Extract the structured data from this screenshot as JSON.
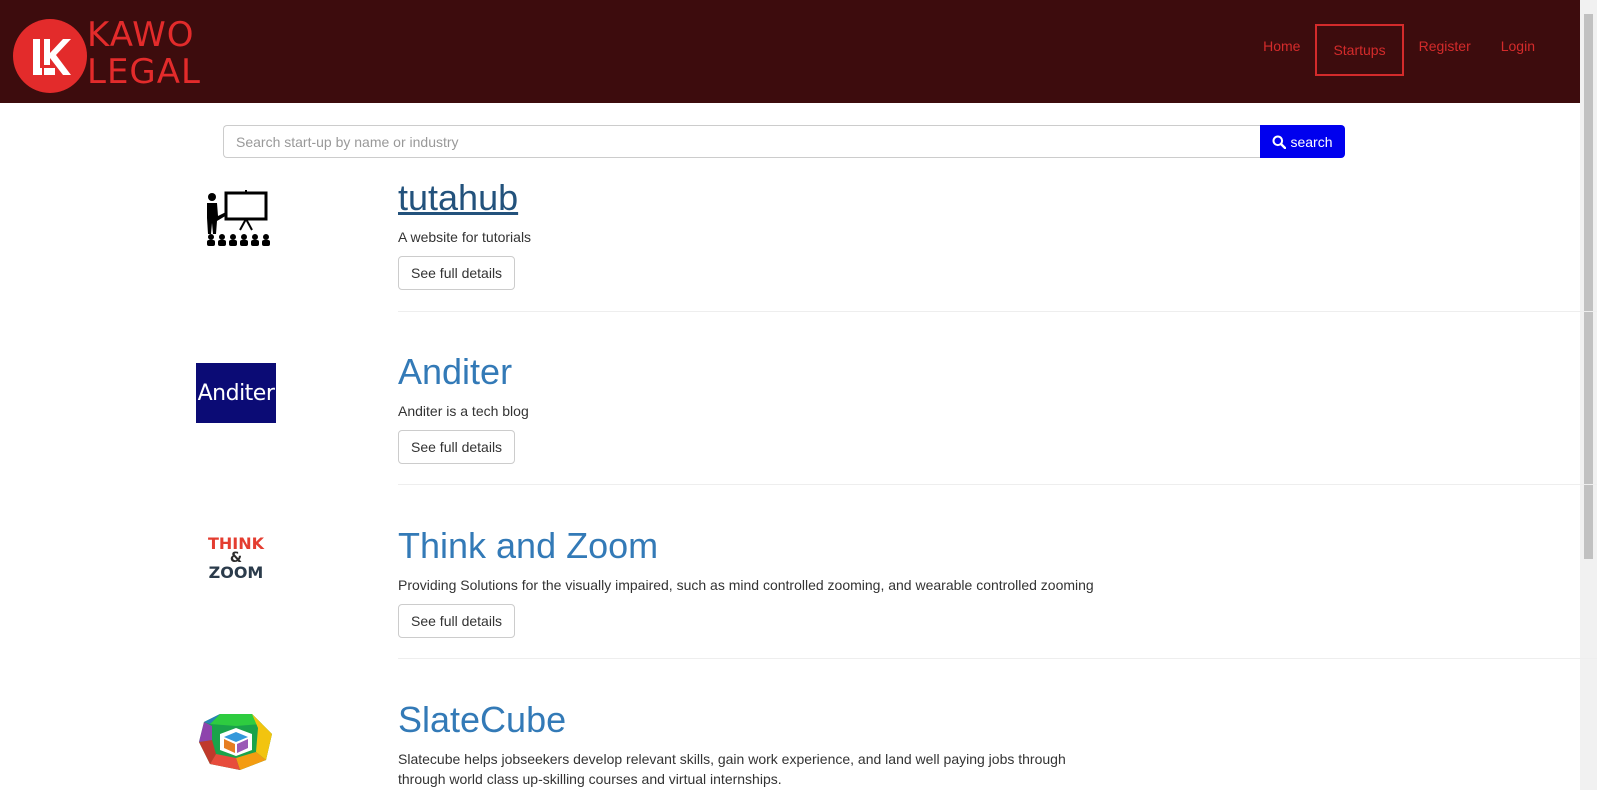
{
  "brand": {
    "line1": "KAWO",
    "line2": "LEGAL",
    "color": "#e32b2b",
    "header_bg": "#3d0c0d"
  },
  "nav": {
    "home": "Home",
    "startups": "Startups",
    "register": "Register",
    "login": "Login"
  },
  "search": {
    "placeholder": "Search start-up by name or industry",
    "button_label": "search",
    "button_icon": "search-icon",
    "button_color": "#0000ee"
  },
  "startups": [
    {
      "name": "tutahub",
      "description": "A website for tutorials",
      "button_label": "See full details",
      "thumb_icon": "presentation-icon"
    },
    {
      "name": "Anditer",
      "description": "Anditer is a tech blog",
      "button_label": "See full details",
      "thumb_text": "Anditer"
    },
    {
      "name": "Think and Zoom",
      "description": "Providing Solutions for the visually impaired, such as mind controlled zooming, and wearable controlled zooming",
      "button_label": "See full details",
      "thumb_text_1": "THINK",
      "thumb_text_2": "&",
      "thumb_text_3": "ZOOM"
    },
    {
      "name": "SlateCube",
      "description": "Slatecube helps jobseekers develop relevant skills, gain work experience, and land well paying jobs through through world class up-skilling courses and virtual internships.",
      "thumb_icon": "cube-hexagon-icon"
    }
  ]
}
